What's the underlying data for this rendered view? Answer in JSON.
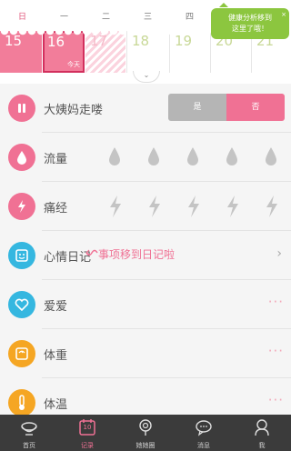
{
  "weekdays": [
    "日",
    "一",
    "二",
    "三",
    "四"
  ],
  "calendar": {
    "days": [
      "15",
      "16",
      "17",
      "18",
      "19",
      "20",
      "21"
    ],
    "today_label": "今天",
    "expand_icon": "double-chevron-down-icon"
  },
  "tip": {
    "text_line1": "健康分析移到",
    "text_line2": "这里了哦！",
    "close": "×"
  },
  "records": {
    "period": {
      "label": "大姨妈走喽",
      "option_yes": "是",
      "option_no": "否",
      "selected": "否",
      "color": "#f07194"
    },
    "flow": {
      "label": "流量",
      "level_count": 5
    },
    "cramps": {
      "label": "痛经",
      "level_count": 5
    },
    "diary": {
      "label": "心情日记",
      "note": "事项移到日记啦",
      "chevron": "›"
    },
    "love": {
      "label": "爱爱",
      "more": "···"
    },
    "weight": {
      "label": "体重",
      "more": "···"
    },
    "temperature": {
      "label": "体温",
      "more": "···"
    }
  },
  "tabs": [
    {
      "label": "首页",
      "icon": "bowl-icon",
      "active": false
    },
    {
      "label": "记录",
      "icon": "calendar-icon",
      "date": "10",
      "active": true
    },
    {
      "label": "她她圈",
      "icon": "lollipop-icon",
      "active": false
    },
    {
      "label": "消息",
      "icon": "chat-bubble-icon",
      "active": false
    },
    {
      "label": "我",
      "icon": "profile-icon",
      "active": false
    }
  ],
  "colors": {
    "accent": "#f07194",
    "calendar_period": "#f27d9a",
    "tip_green": "#8cc63f",
    "tabbar": "#3b3b3b"
  }
}
